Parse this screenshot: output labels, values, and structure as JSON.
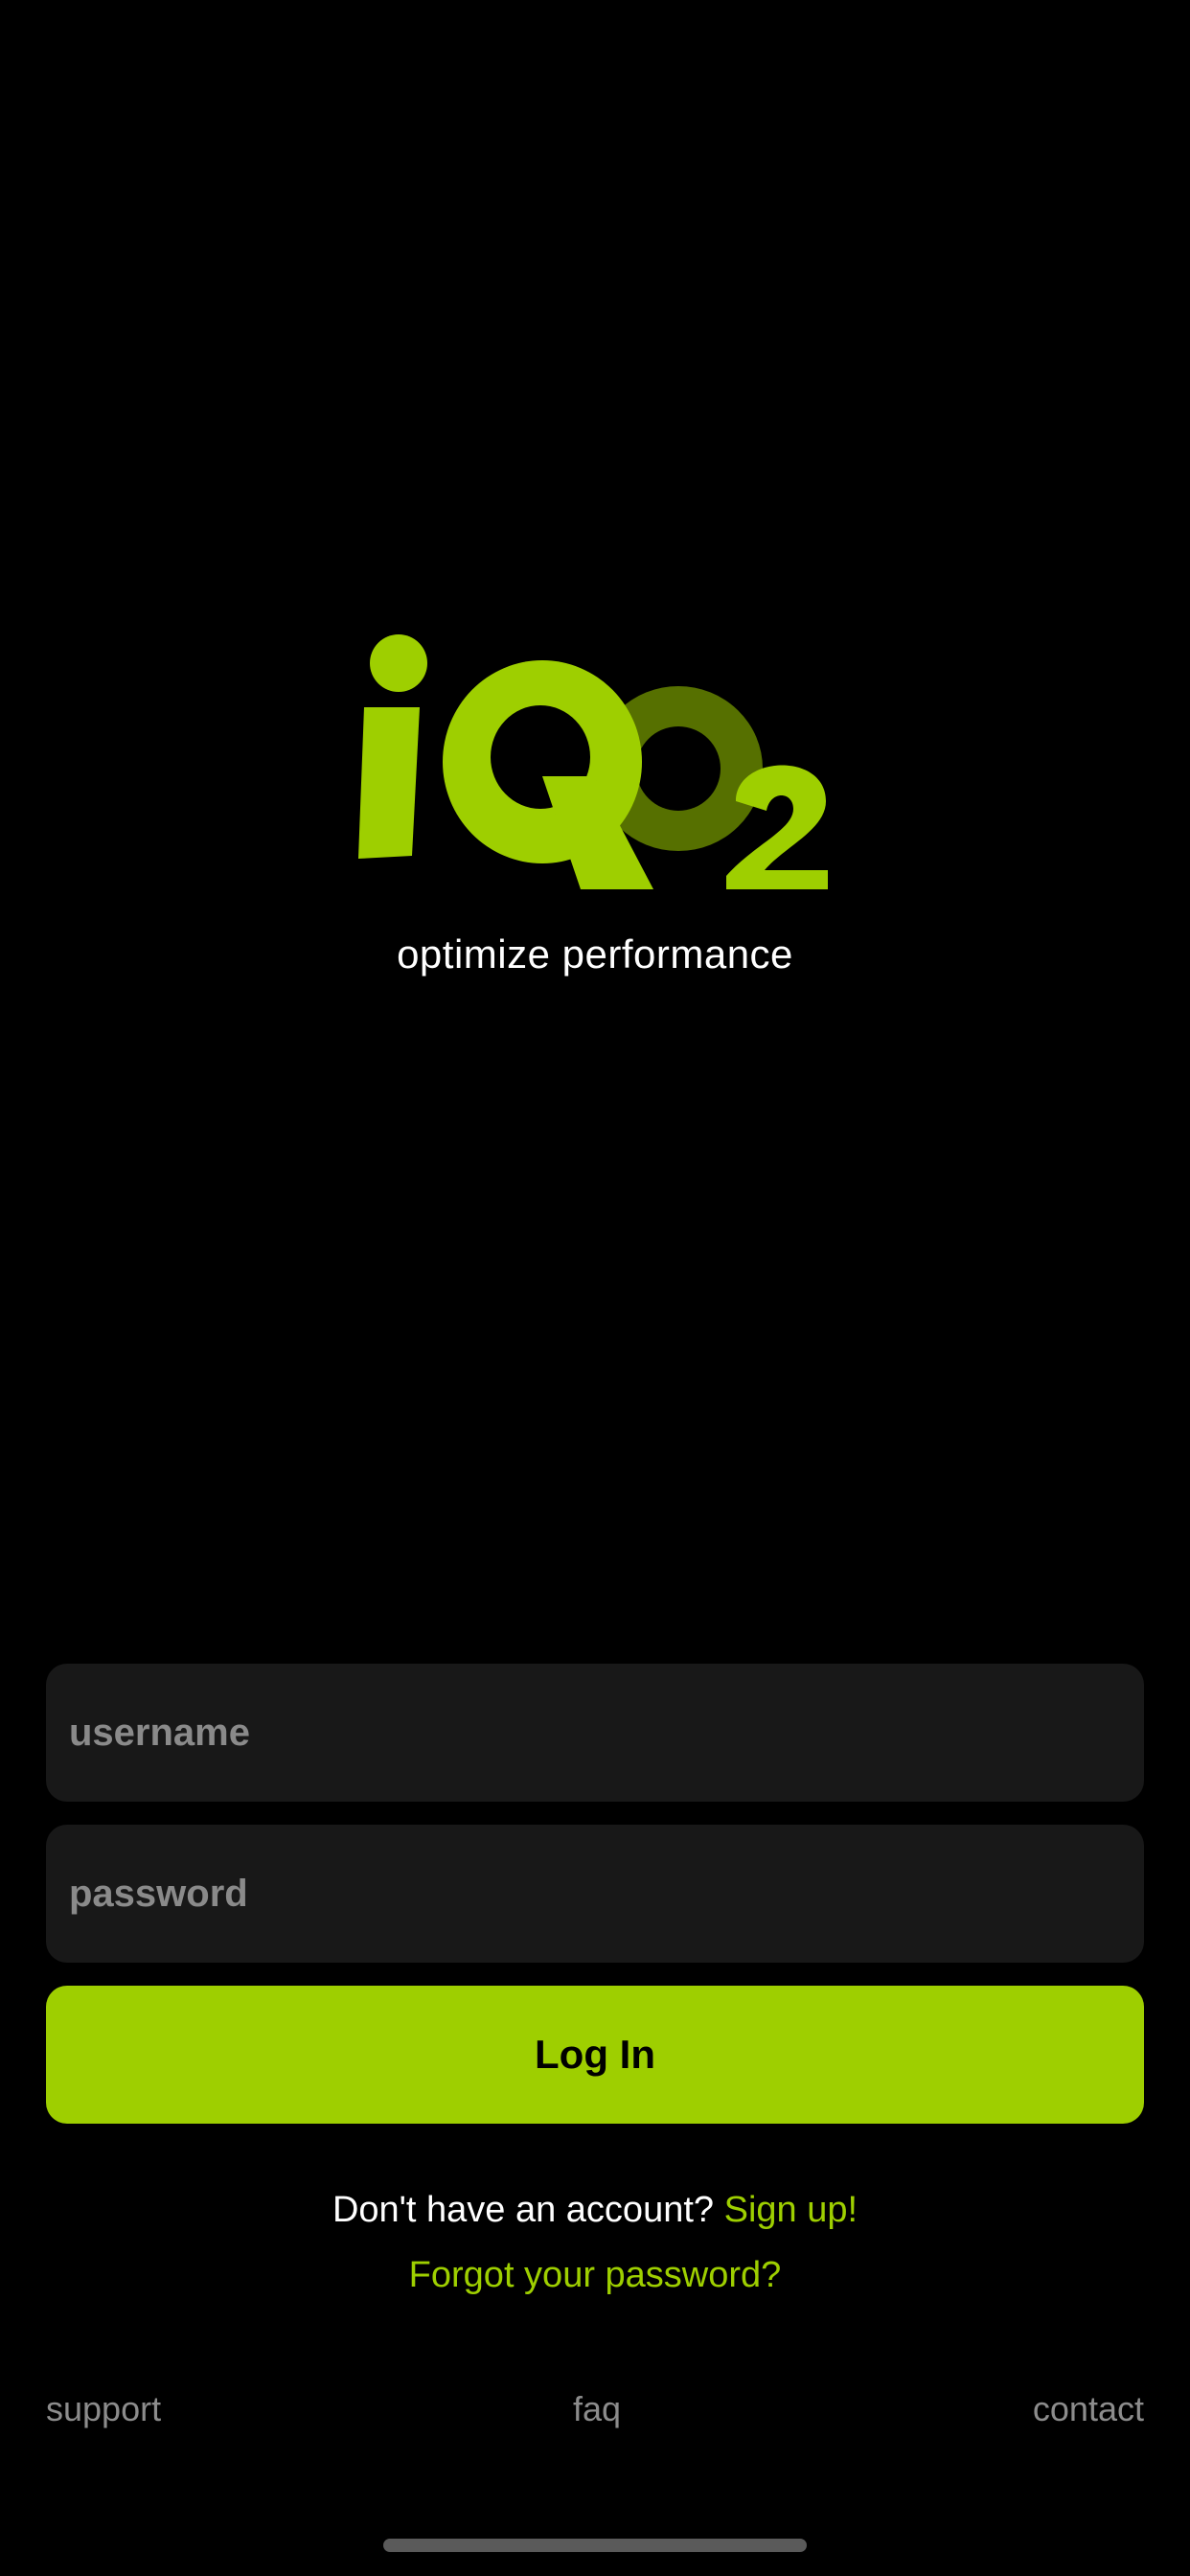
{
  "brand": {
    "logo_text": "iQO2",
    "tagline": "optimize performance",
    "accent_color": "#9ecf00",
    "secondary_logo_color": "#567000"
  },
  "form": {
    "username_placeholder": "username",
    "password_placeholder": "password",
    "login_label": "Log In"
  },
  "signup": {
    "prompt": "Don't have an account? ",
    "link_label": "Sign up!"
  },
  "forgot_password_label": "Forgot your password?",
  "footer": {
    "support": "support",
    "faq": "faq",
    "contact": "contact"
  }
}
